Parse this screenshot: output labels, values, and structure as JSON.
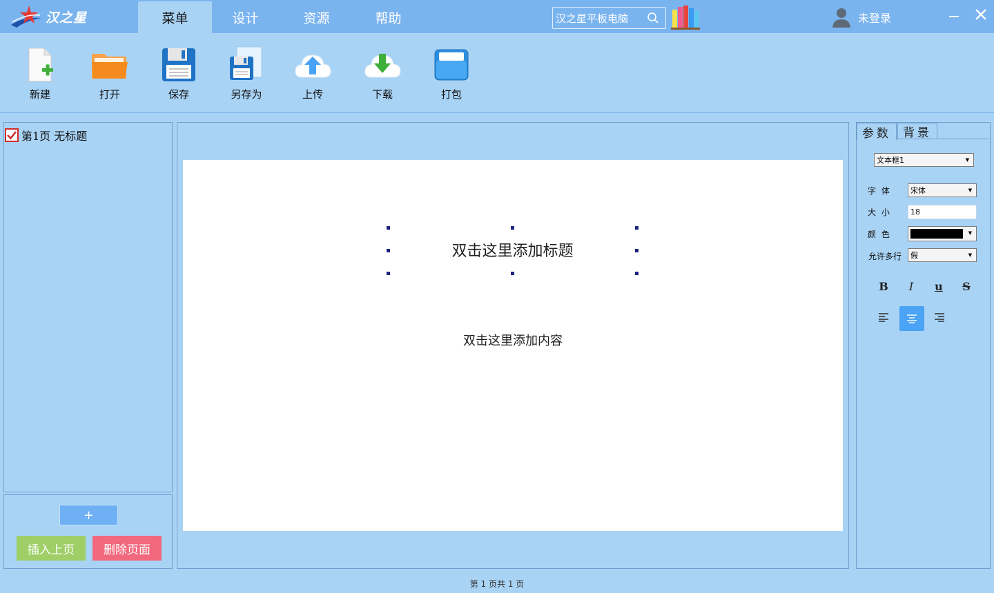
{
  "app": {
    "logo_text": "汉之星"
  },
  "menu": {
    "tabs": [
      {
        "label": "菜单",
        "active": true
      },
      {
        "label": "设计",
        "active": false
      },
      {
        "label": "资源",
        "active": false
      },
      {
        "label": "帮助",
        "active": false
      }
    ]
  },
  "search": {
    "value": "汉之星平板电脑"
  },
  "user": {
    "status": "未登录"
  },
  "toolbar": {
    "new_label": "新建",
    "open_label": "打开",
    "save_label": "保存",
    "save_as_label": "另存为",
    "upload_label": "上传",
    "download_label": "下载",
    "pack_label": "打包"
  },
  "pages": {
    "items": [
      {
        "label": "第1页 无标题",
        "checked": true
      }
    ],
    "add_label": "+",
    "insert_label": "插入上页",
    "delete_label": "删除页面"
  },
  "canvas": {
    "title_placeholder": "双击这里添加标题",
    "content_placeholder": "双击这里添加内容"
  },
  "properties": {
    "tabs": [
      {
        "label": "参数",
        "active": true
      },
      {
        "label": "背景",
        "active": false
      }
    ],
    "element_select": "文本框1",
    "font_label": "字 体",
    "font_value": "宋体",
    "size_label": "大 小",
    "size_value": "18",
    "color_label": "颜 色",
    "color_value": "#000000",
    "multiline_label": "允许多行",
    "multiline_value": "假",
    "bold_label": "B",
    "italic_label": "I",
    "underline_label": "u",
    "strike_label": "S",
    "align_active": "center"
  },
  "status": {
    "text": "第 1 页共 1 页"
  },
  "colors": {
    "topbar": "#7ab4ef",
    "panel": "#a9d3f5",
    "insert_button": "#9fcf66",
    "delete_button": "#f2687c",
    "accent": "#4aa3f5"
  }
}
